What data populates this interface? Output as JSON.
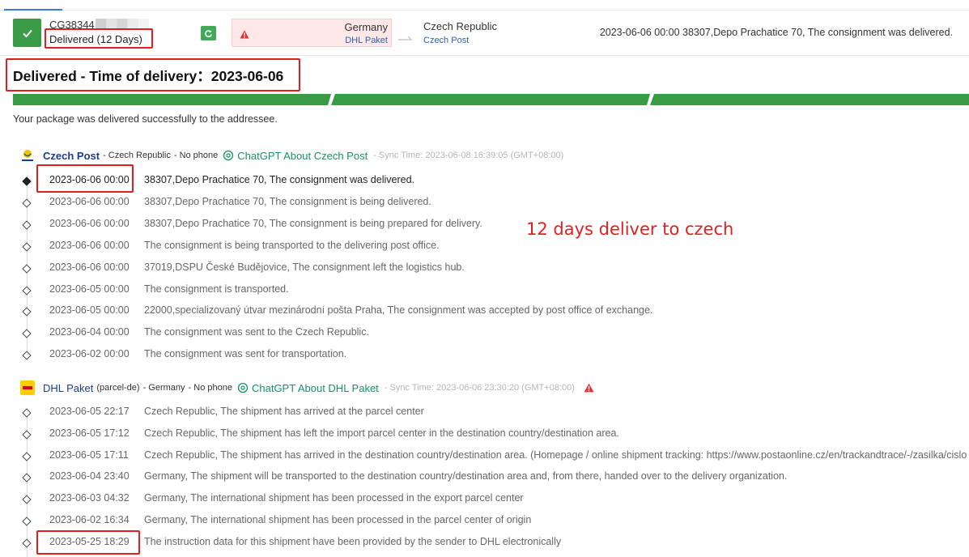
{
  "header": {
    "tracking_number": "CG38344",
    "status": "Delivered (12 Days)",
    "origin_country": "Germany",
    "origin_carrier": "DHL Paket",
    "destination_country": "Czech Republic",
    "destination_carrier": "Czech Post",
    "latest_event": "2023-06-06 00:00  38307,Depo Prachatice 70, The consignment was delivered."
  },
  "summary": {
    "title": "Delivered - Time of delivery：2023-06-06",
    "message": "Your package was delivered successfully to the addressee.",
    "progress_segments": 4,
    "progress_completed": 4
  },
  "annotation": "12 days deliver to czech",
  "colors": {
    "success": "#3a9b47",
    "annotation": "#e02020",
    "link": "#1a3d8f",
    "chatgpt": "#17906b",
    "origin_bg": "#fde7e7"
  },
  "carriers": [
    {
      "name": "Czech Post",
      "sub": "- Czech Republic",
      "phone": "- No phone",
      "chatgpt": "ChatGPT About Czech Post",
      "sync": "- Sync Time: 2023-06-08 16:39:05 (GMT+08:00)",
      "icon": "czech-post-logo",
      "events": [
        {
          "time": "2023-06-06 00:00",
          "desc": "38307,Depo Prachatice 70, The consignment was delivered."
        },
        {
          "time": "2023-06-06 00:00",
          "desc": "38307,Depo Prachatice 70, The consignment is being delivered."
        },
        {
          "time": "2023-06-06 00:00",
          "desc": "38307,Depo Prachatice 70, The consignment is being prepared for delivery."
        },
        {
          "time": "2023-06-06 00:00",
          "desc": "The consignment is being transported to the delivering post office."
        },
        {
          "time": "2023-06-06 00:00",
          "desc": "37019,DSPU České Budějovice, The consignment left the logistics hub."
        },
        {
          "time": "2023-06-05 00:00",
          "desc": "The consignment is transported."
        },
        {
          "time": "2023-06-05 00:00",
          "desc": "22000,specializovaný útvar mezinárodní pošta Praha, The consignment was accepted by post office of exchange."
        },
        {
          "time": "2023-06-04 00:00",
          "desc": "The consignment was sent to the Czech Republic."
        },
        {
          "time": "2023-06-02 00:00",
          "desc": "The consignment was sent for transportation."
        }
      ]
    },
    {
      "name": "DHL Paket",
      "sub": "(parcel-de)",
      "region": "- Germany",
      "phone": "- No phone",
      "chatgpt": "ChatGPT About DHL Paket",
      "sync": "- Sync Time: 2023-06-06 23:30:20 (GMT+08:00)",
      "icon": "dhl-logo",
      "events": [
        {
          "time": "2023-06-05 22:17",
          "desc": "Czech Republic, The shipment has arrived at the parcel center"
        },
        {
          "time": "2023-06-05 17:12",
          "desc": "Czech Republic, The shipment has left the import parcel center in the destination country/destination area."
        },
        {
          "time": "2023-06-05 17:11",
          "desc": "Czech Republic, The shipment has arrived in the destination country/destination area. (Homepage / online shipment tracking: https://www.postaonline.cz/en/trackandtrace/-/zasilka/cislo"
        },
        {
          "time": "2023-06-04 23:40",
          "desc": "Germany, The shipment will be transported to the destination country/destination area and, from there, handed over to the delivery organization."
        },
        {
          "time": "2023-06-03 04:32",
          "desc": "Germany, The international shipment has been processed in the export parcel center"
        },
        {
          "time": "2023-06-02 16:34",
          "desc": "Germany, The international shipment has been processed in the parcel center of origin"
        },
        {
          "time": "2023-05-25 18:29",
          "desc": "The instruction data for this shipment have been provided by the sender to DHL electronically"
        }
      ]
    }
  ]
}
